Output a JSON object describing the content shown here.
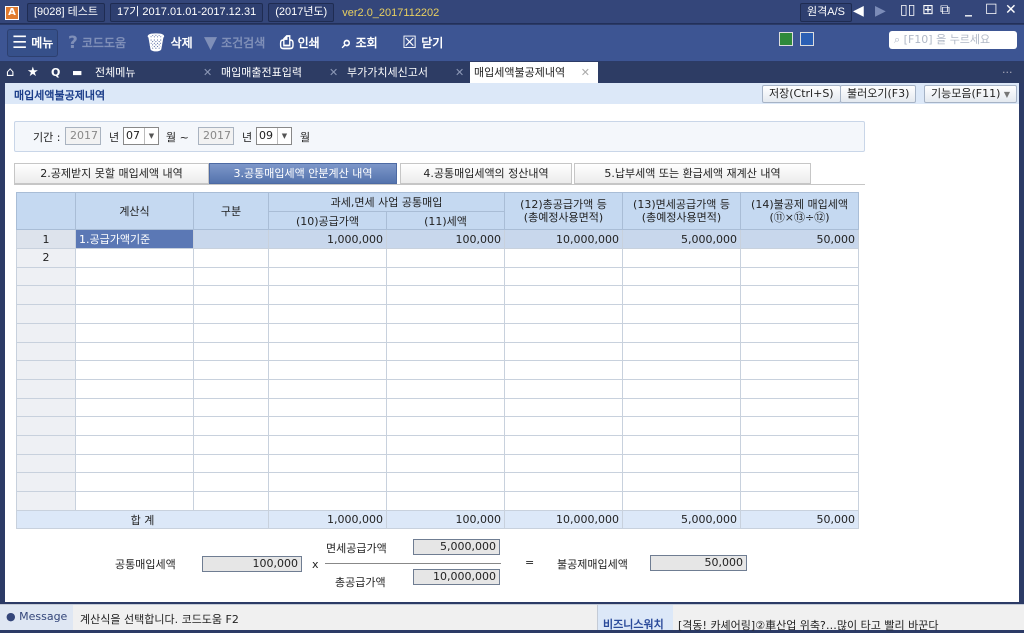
{
  "titlebar": {
    "company": "[9028] 테스트",
    "period": "17기  2017.01.01-2017.12.31",
    "year": "(2017년도)",
    "version": "ver2.0_2017112202",
    "remote_as": "원격A/S"
  },
  "toolbar": {
    "menu": "메뉴",
    "code_help": "코드도움",
    "delete": "삭제",
    "filter": "조건검색",
    "print": "인쇄",
    "search": "조회",
    "close": "닫기",
    "search_placeholder": "[F10] 을 누르세요"
  },
  "tabs": {
    "all_menu": "전체메뉴",
    "items": [
      "매입매출전표입력",
      "부가가치세신고서",
      "매입세액불공제내역"
    ]
  },
  "page": {
    "title": "매입세액불공제내역",
    "save": "저장(Ctrl+S)",
    "load": "불러오기(F3)",
    "functions": "기능모음(F11)"
  },
  "period": {
    "label": "기간 :",
    "from_year": "2017",
    "year_unit": "년",
    "from_month": "07",
    "month_unit": "월 ~",
    "to_year": "2017",
    "to_month": "09",
    "month_unit2": "월"
  },
  "subtabs": [
    "2.공제받지 못할 매입세액 내역",
    "3.공통매입세액 안분계산 내역",
    "4.공통매입세액의 정산내역",
    "5.납부세액 또는 환급세액 재계산 내역"
  ],
  "grid": {
    "headers": {
      "formula": "계산식",
      "category": "구분",
      "common": "과세,면세 사업 공통매입",
      "supply": "(10)공급가액",
      "tax": "(11)세액",
      "total_supply": "(12)총공급가액 등",
      "total_supply_sub": "(총예정사용면적)",
      "exempt_supply": "(13)면세공급가액 등",
      "exempt_supply_sub": "(총예정사용면적)",
      "nondeduct": "(14)불공제 매입세액",
      "nondeduct_sub": "(⑪×⑬÷⑫)"
    },
    "rows": [
      {
        "no": "1",
        "formula": "1.공급가액기준",
        "category": "",
        "supply": "1,000,000",
        "tax": "100,000",
        "total_supply": "10,000,000",
        "exempt_supply": "5,000,000",
        "nondeduct": "50,000"
      },
      {
        "no": "2"
      }
    ],
    "total": {
      "label": "합 계",
      "supply": "1,000,000",
      "tax": "100,000",
      "total_supply": "10,000,000",
      "exempt_supply": "5,000,000",
      "nondeduct": "50,000"
    }
  },
  "formula": {
    "common_tax_label": "공통매입세액",
    "common_tax": "100,000",
    "times": "x",
    "exempt_label": "면세공급가액",
    "exempt": "5,000,000",
    "total_label": "총공급가액",
    "total": "10,000,000",
    "equals": "=",
    "result_label": "불공제매입세액",
    "result": "50,000"
  },
  "status": {
    "message_label": "Message",
    "message": "계산식을 선택합니다. 코드도움 F2",
    "biz_label": "비즈니스워치",
    "news": "[격동! 카셰어링]②車산업 위축?…많이 타고 빨리 바꾼다"
  }
}
